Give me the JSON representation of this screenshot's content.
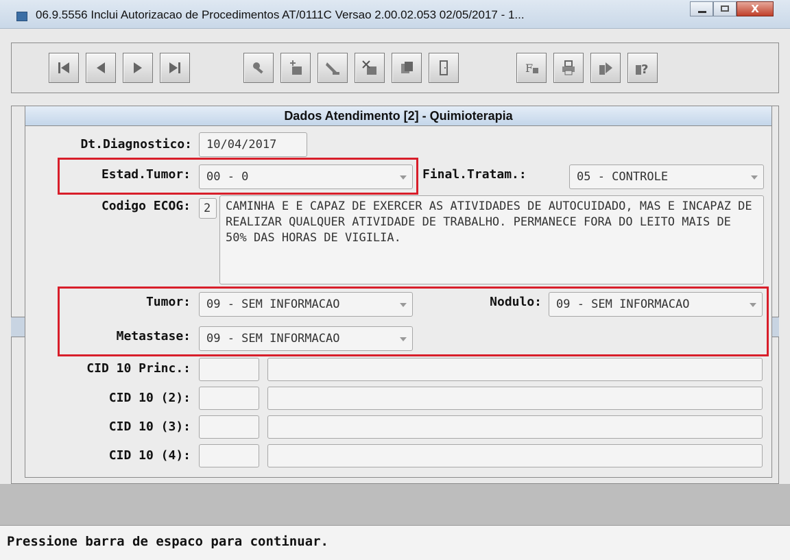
{
  "window": {
    "title": "06.9.5556   Inclui  Autorizacao de Procedimentos AT/0111C Versao 2.00.02.053 02/05/2017 - 1...",
    "close_label": "X"
  },
  "toolbar": {
    "buttons": [
      "first-icon",
      "previous-icon",
      "next-icon",
      "last-icon",
      "key-icon",
      "add-icon",
      "edit-icon",
      "delete-icon",
      "copy-icon",
      "exit-door-icon",
      "filter-icon",
      "print-icon",
      "navigate-icon",
      "help-icon"
    ]
  },
  "panel": {
    "title": "Dados Atendimento [2] - Quimioterapia"
  },
  "form": {
    "dt_diagnostico": {
      "label": "Dt.Diagnostico:",
      "value": "10/04/2017"
    },
    "estad_tumor": {
      "label": "Estad.Tumor:",
      "value": "00 - 0"
    },
    "final_tratam": {
      "label": "Final.Tratam.:",
      "value": "05 - CONTROLE"
    },
    "codigo_ecog": {
      "label": "Codigo ECOG:",
      "value": "2",
      "description": "CAMINHA E E CAPAZ DE EXERCER AS ATIVIDADES DE AUTOCUIDADO, MAS E INCAPAZ DE REALIZAR QUALQUER ATIVIDADE DE TRABALHO. PERMANECE FORA DO LEITO MAIS DE 50% DAS HORAS DE VIGILIA."
    },
    "tumor": {
      "label": "Tumor:",
      "value": "09 - SEM INFORMACAO"
    },
    "nodulo": {
      "label": "Nodulo:",
      "value": "09 - SEM INFORMACAO"
    },
    "metastase": {
      "label": "Metastase:",
      "value": "09 - SEM INFORMACAO"
    },
    "cid_princ": {
      "label": "CID 10 Princ.:",
      "code": "",
      "description": ""
    },
    "cid_2": {
      "label": "CID 10 (2):",
      "code": "",
      "description": ""
    },
    "cid_3": {
      "label": "CID 10 (3):",
      "code": "",
      "description": ""
    },
    "cid_4": {
      "label": "CID 10 (4):",
      "code": "",
      "description": ""
    }
  },
  "status_bar": {
    "message": "Pressione barra de espaco para continuar."
  },
  "colors": {
    "highlight": "#d81e2a",
    "panel_title_bg": "#c4d6ea"
  }
}
